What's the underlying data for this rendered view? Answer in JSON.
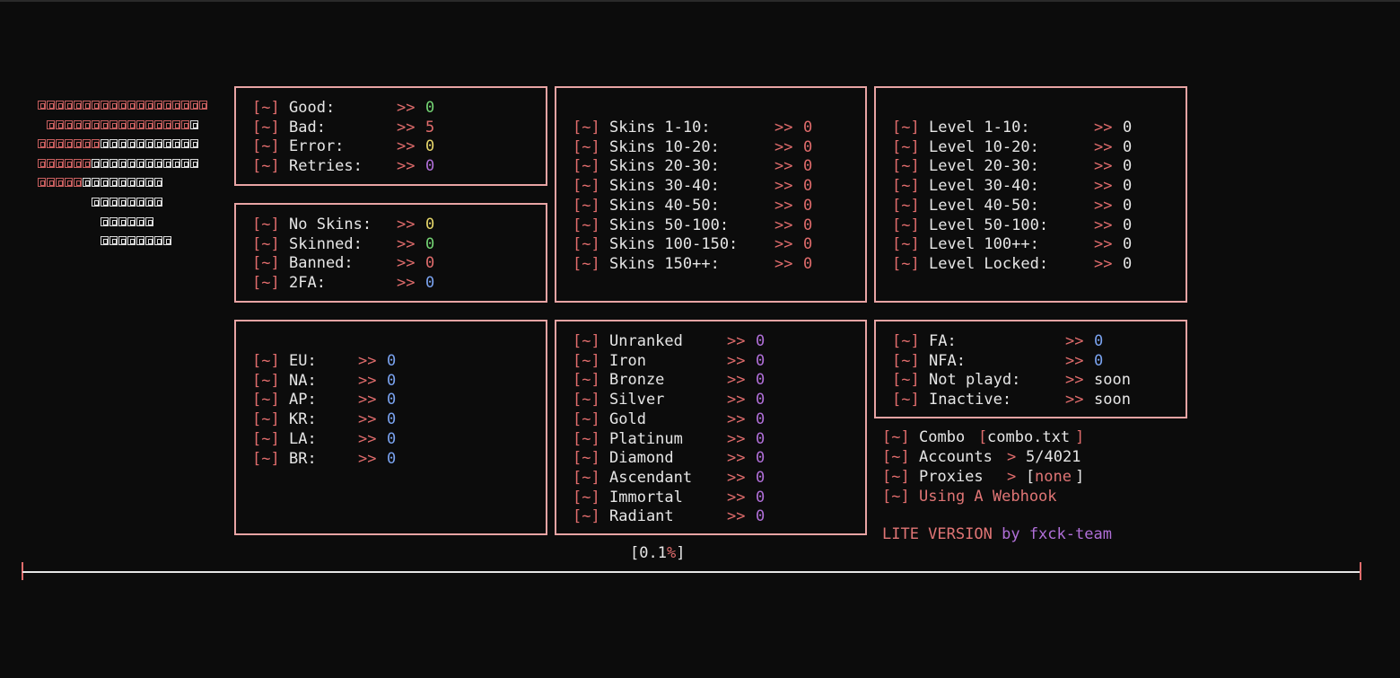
{
  "logo": {
    "rows": [
      {
        "red": 19,
        "white": 0,
        "indent": 0
      },
      {
        "red": 16,
        "white": 1,
        "indent": 1
      },
      {
        "red": 7,
        "white": 11,
        "indent": 0
      },
      {
        "red": 6,
        "white": 12,
        "indent": 0
      },
      {
        "red": 5,
        "white": 9,
        "indent": 0
      },
      {
        "red": 0,
        "white": 8,
        "indent": 6
      },
      {
        "red": 0,
        "white": 6,
        "indent": 7
      },
      {
        "red": 0,
        "white": 8,
        "indent": 7
      }
    ]
  },
  "prefix": "[~]",
  "arrow": ">>",
  "status": {
    "items": [
      {
        "label": "Good:",
        "value": "0",
        "color": "#74d474"
      },
      {
        "label": "Bad:",
        "value": "5",
        "color": "#e06c6c"
      },
      {
        "label": "Error:",
        "value": "0",
        "color": "#e6d66a"
      },
      {
        "label": "Retries:",
        "value": "0",
        "color": "#b06fd8"
      }
    ]
  },
  "account_state": {
    "items": [
      {
        "label": "No Skins:",
        "value": "0",
        "color": "#e6d66a"
      },
      {
        "label": "Skinned:",
        "value": "0",
        "color": "#74d474"
      },
      {
        "label": "Banned:",
        "value": "0",
        "color": "#e06c6c"
      },
      {
        "label": "2FA:",
        "value": "0",
        "color": "#7aa3f0"
      }
    ]
  },
  "skins": {
    "items": [
      {
        "label": "Skins 1-10:",
        "value": "0"
      },
      {
        "label": "Skins 10-20:",
        "value": "0"
      },
      {
        "label": "Skins 20-30:",
        "value": "0"
      },
      {
        "label": "Skins 30-40:",
        "value": "0"
      },
      {
        "label": "Skins 40-50:",
        "value": "0"
      },
      {
        "label": "Skins 50-100:",
        "value": "0"
      },
      {
        "label": "Skins 100-150:",
        "value": "0"
      },
      {
        "label": "Skins 150++:",
        "value": "0"
      }
    ],
    "value_color": "#e06c6c"
  },
  "levels": {
    "items": [
      {
        "label": "Level 1-10:",
        "value": "0"
      },
      {
        "label": "Level 10-20:",
        "value": "0"
      },
      {
        "label": "Level 20-30:",
        "value": "0"
      },
      {
        "label": "Level 30-40:",
        "value": "0"
      },
      {
        "label": "Level 40-50:",
        "value": "0"
      },
      {
        "label": "Level 50-100:",
        "value": "0"
      },
      {
        "label": "Level 100++:",
        "value": "0"
      },
      {
        "label": "Level Locked:",
        "value": "0"
      }
    ],
    "value_color": "#e6e6e6"
  },
  "regions": {
    "items": [
      {
        "label": "EU:",
        "value": "0"
      },
      {
        "label": "NA:",
        "value": "0"
      },
      {
        "label": "AP:",
        "value": "0"
      },
      {
        "label": "KR:",
        "value": "0"
      },
      {
        "label": "LA:",
        "value": "0"
      },
      {
        "label": "BR:",
        "value": "0"
      }
    ],
    "value_color": "#7aa3f0"
  },
  "ranks": {
    "items": [
      {
        "label": "Unranked",
        "value": "0"
      },
      {
        "label": "Iron",
        "value": "0"
      },
      {
        "label": "Bronze",
        "value": "0"
      },
      {
        "label": "Silver",
        "value": "0"
      },
      {
        "label": "Gold",
        "value": "0"
      },
      {
        "label": "Platinum",
        "value": "0"
      },
      {
        "label": "Diamond",
        "value": "0"
      },
      {
        "label": "Ascendant",
        "value": "0"
      },
      {
        "label": "Immortal",
        "value": "0"
      },
      {
        "label": "Radiant",
        "value": "0"
      }
    ],
    "value_color": "#b06fd8"
  },
  "access": {
    "items": [
      {
        "label": "FA:",
        "value": "0",
        "color": "#7aa3f0"
      },
      {
        "label": "NFA:",
        "value": "0",
        "color": "#7aa3f0"
      },
      {
        "label": "Not playd:",
        "value": "soon",
        "color": "#e6e6e6"
      },
      {
        "label": "Inactive:",
        "value": "soon",
        "color": "#e6e6e6"
      }
    ]
  },
  "info": {
    "combo_label": "Combo",
    "combo_file": "combo.txt",
    "accounts_label": "Accounts",
    "accounts_value": "5/4021",
    "proxies_label": "Proxies",
    "proxies_value": "none",
    "webhook_label": "Using A Webhook"
  },
  "footer": {
    "lite": "LITE VERSION",
    "by": "by",
    "team": "fxck-team"
  },
  "progress": {
    "percent_text": "0.1",
    "percent_sign": "%",
    "fraction": 0.001
  }
}
